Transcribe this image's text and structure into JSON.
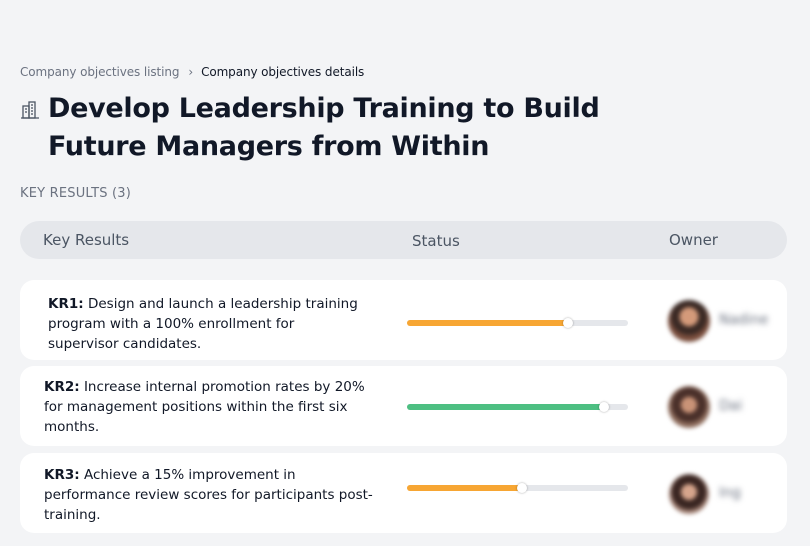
{
  "breadcrumb": {
    "parent": "Company objectives listing",
    "separator": "›",
    "current": "Company objectives details"
  },
  "title_icon": "building-icon",
  "title": "Develop Leadership Training to Build Future Managers from Within",
  "section_label": "KEY RESULTS (3)",
  "table_header": {
    "key_results": "Key Results",
    "status": "Status",
    "owner": "Owner"
  },
  "colors": {
    "orange": "#f7a633",
    "green": "#4dbf82",
    "track": "#e5e7eb"
  },
  "key_results": [
    {
      "code": "KR1:",
      "text": "Design and launch a leadership training program with a 100% enrollment for supervisor candidates.",
      "progress": 0.73,
      "color": "#f7a633",
      "owner": "Nadine"
    },
    {
      "code": "KR2:",
      "text": "Increase internal promotion rates by 20% for management positions within the first six months.",
      "progress": 0.89,
      "color": "#4dbf82",
      "owner": "Dai"
    },
    {
      "code": "KR3:",
      "text": "Achieve a 15% improvement in performance review scores for participants post-training.",
      "progress": 0.52,
      "color": "#f7a633",
      "owner": "Ing"
    }
  ]
}
